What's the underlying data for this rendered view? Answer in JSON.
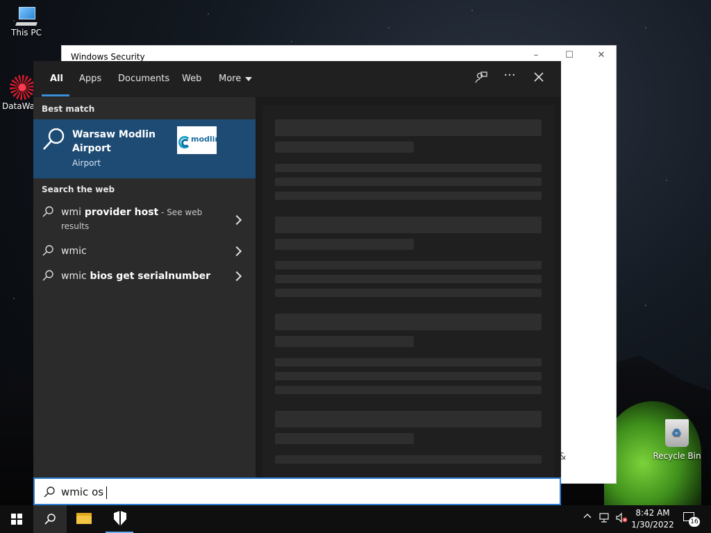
{
  "desktop": {
    "icons": [
      {
        "label": "This PC",
        "icon": "computer-icon"
      },
      {
        "label": "DataWag",
        "icon": "datawag-app-icon"
      },
      {
        "label": "Recycle Bin",
        "icon": "recycle-bin-icon"
      }
    ]
  },
  "background_window": {
    "title": "Windows Security",
    "controls": {
      "minimize": "–",
      "maximize": "☐",
      "close": "✕"
    },
    "partial_text": "&"
  },
  "search_panel": {
    "tabs": [
      {
        "label": "All",
        "active": true
      },
      {
        "label": "Apps"
      },
      {
        "label": "Documents"
      },
      {
        "label": "Web"
      },
      {
        "label": "More"
      }
    ],
    "header_icons": [
      "feedback-icon",
      "more-options-icon",
      "close-icon"
    ],
    "best_match": {
      "section_label": "Best match",
      "title": "Warsaw Modlin Airport",
      "subtitle": "Airport",
      "logo_text": "modlin"
    },
    "web_section": {
      "section_label": "Search the web",
      "items": [
        {
          "prefix": "wmi",
          "bold": " provider host",
          "suffix": " - See web results"
        },
        {
          "prefix": "wmic",
          "bold": "",
          "suffix": ""
        },
        {
          "prefix": "wmic",
          "bold": " bios get serialnumber",
          "suffix": ""
        }
      ]
    }
  },
  "search_box": {
    "value": "wmic os"
  },
  "taskbar": {
    "buttons": [
      "start-button",
      "search-button",
      "file-explorer-button",
      "windows-security-button"
    ],
    "clock": {
      "time": "8:42 AM",
      "date": "1/30/2022"
    },
    "notifications": {
      "count": "16"
    },
    "colors": {
      "accent": "#3b8fd9",
      "selected": "#1e4b74"
    }
  }
}
